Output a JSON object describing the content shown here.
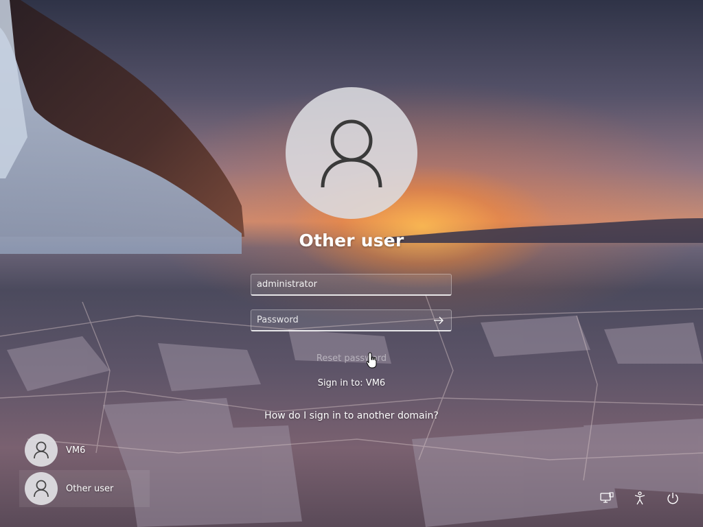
{
  "login": {
    "title": "Other user",
    "username_value": "administrator",
    "password_placeholder": "Password",
    "reset_password": "Reset password",
    "sign_in_to": "Sign in to: VM6",
    "other_domain_link": "How do I sign in to another domain?"
  },
  "user_switcher": {
    "users": [
      {
        "label": "VM6",
        "icon": "user-icon"
      },
      {
        "label": "Other user",
        "icon": "user-icon",
        "selected": true
      }
    ]
  },
  "system_icons": [
    "network-icon",
    "accessibility-icon",
    "power-icon"
  ],
  "colors": {
    "avatar_bg": "#dcdce0",
    "text": "#ffffff",
    "sunset_glow": "#ffbe50"
  }
}
